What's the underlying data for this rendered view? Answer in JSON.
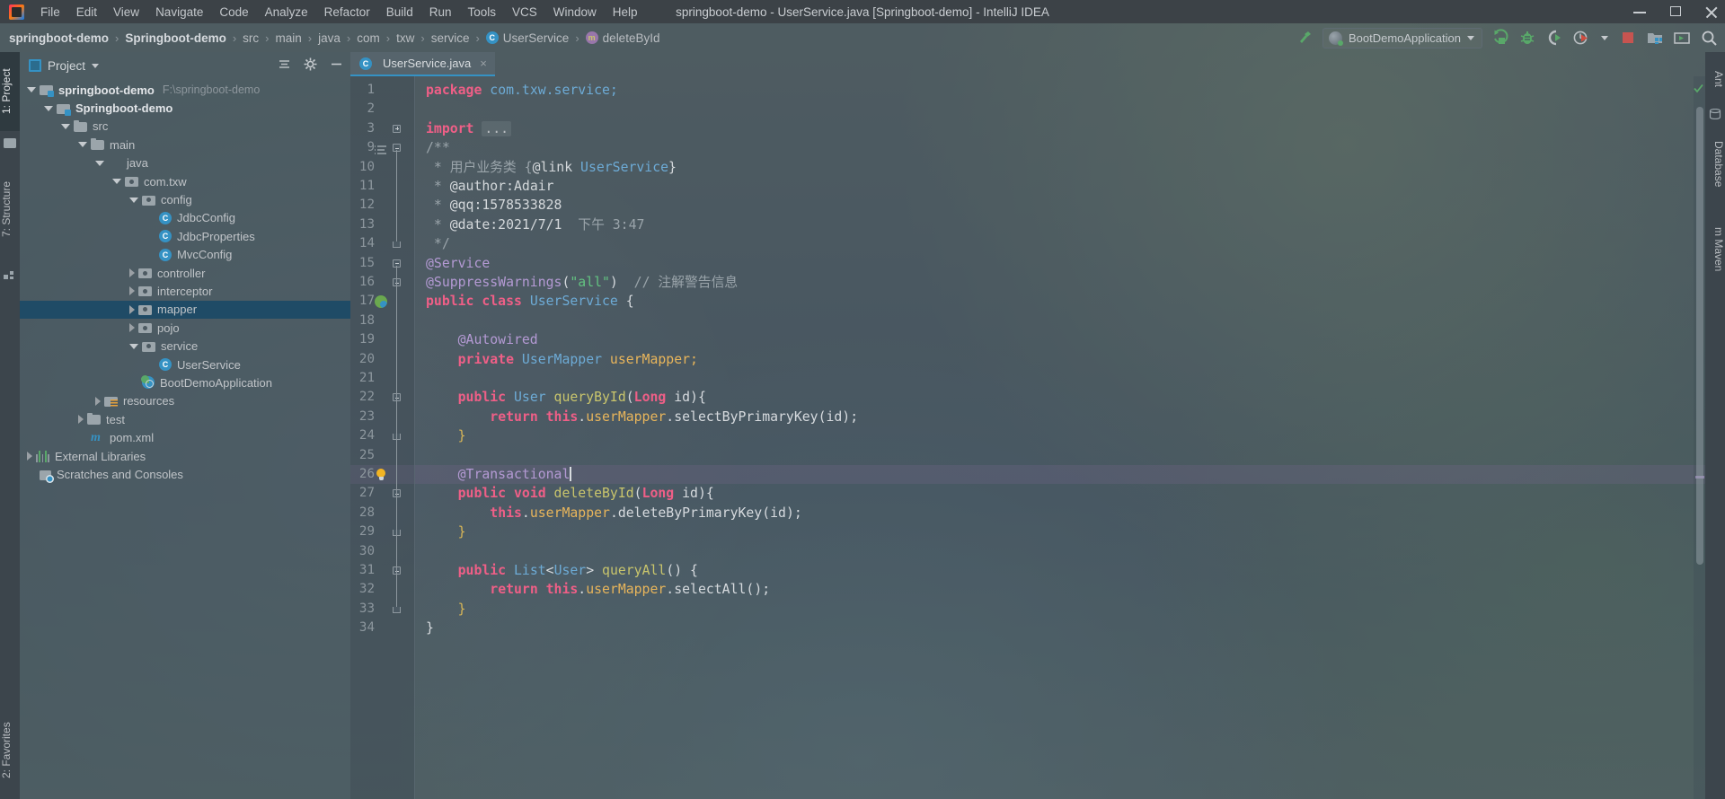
{
  "window": {
    "title": "springboot-demo - UserService.java [Springboot-demo] - IntelliJ IDEA",
    "minimize_label": "Minimize",
    "maximize_label": "Maximize",
    "close_label": "Close"
  },
  "menu": {
    "logo_name": "intellij-idea-logo",
    "items": [
      {
        "label": "File"
      },
      {
        "label": "Edit"
      },
      {
        "label": "View"
      },
      {
        "label": "Navigate"
      },
      {
        "label": "Code"
      },
      {
        "label": "Analyze"
      },
      {
        "label": "Refactor"
      },
      {
        "label": "Build"
      },
      {
        "label": "Run"
      },
      {
        "label": "Tools"
      },
      {
        "label": "VCS"
      },
      {
        "label": "Window"
      },
      {
        "label": "Help"
      }
    ]
  },
  "breadcrumb": {
    "items": [
      {
        "label": "springboot-demo",
        "bold": true,
        "icon": ""
      },
      {
        "label": "Springboot-demo",
        "bold": true,
        "icon": ""
      },
      {
        "label": "src",
        "bold": false,
        "icon": ""
      },
      {
        "label": "main",
        "bold": false,
        "icon": ""
      },
      {
        "label": "java",
        "bold": false,
        "icon": ""
      },
      {
        "label": "com",
        "bold": false,
        "icon": ""
      },
      {
        "label": "txw",
        "bold": false,
        "icon": ""
      },
      {
        "label": "service",
        "bold": false,
        "icon": ""
      },
      {
        "label": "UserService",
        "bold": false,
        "icon": "C"
      },
      {
        "label": "deleteById",
        "bold": false,
        "icon": "m"
      }
    ],
    "separator": "›"
  },
  "toolbar": {
    "run_config_label": "BootDemoApplication",
    "icons": [
      {
        "name": "build-hammer-icon"
      },
      {
        "name": "run-icon"
      },
      {
        "name": "debug-icon"
      },
      {
        "name": "run-with-coverage-icon"
      },
      {
        "name": "profiler-icon"
      },
      {
        "name": "profiler-dropdown-icon"
      },
      {
        "name": "stop-icon"
      },
      {
        "name": "project-structure-icon"
      },
      {
        "name": "terminal-icon"
      },
      {
        "name": "search-everywhere-icon"
      }
    ]
  },
  "left_strip": {
    "tabs": [
      {
        "label": "1: Project",
        "active": true
      },
      {
        "label": "7: Structure",
        "active": false
      }
    ],
    "bottom_tabs": [
      {
        "label": "2: Favorites"
      }
    ],
    "icons": [
      {
        "name": "project-folder-icon"
      },
      {
        "name": "structure-icon"
      }
    ]
  },
  "right_strip": {
    "tabs": [
      {
        "label": "Ant",
        "active": false
      },
      {
        "label": "Database",
        "active": false
      },
      {
        "label": "m Maven",
        "active": false
      }
    ]
  },
  "project_panel": {
    "title": "Project",
    "dropdown_name": "project-view-dropdown",
    "collapse_all_name": "collapse-all-icon",
    "settings_name": "gear-icon",
    "hide_name": "hide-icon",
    "tree": [
      {
        "label": "springboot-demo",
        "path": "F:\\springboot-demo",
        "depth": 0,
        "twisty": "down",
        "icon": "mod",
        "bold": true,
        "selected": false
      },
      {
        "label": "Springboot-demo",
        "path": "",
        "depth": 1,
        "twisty": "down",
        "icon": "mod",
        "bold": true,
        "selected": false
      },
      {
        "label": "src",
        "path": "",
        "depth": 2,
        "twisty": "down",
        "icon": "folder",
        "bold": false,
        "selected": false
      },
      {
        "label": "main",
        "path": "",
        "depth": 3,
        "twisty": "down",
        "icon": "folder",
        "bold": false,
        "selected": false
      },
      {
        "label": "java",
        "path": "",
        "depth": 4,
        "twisty": "down",
        "icon": "folder-blue",
        "bold": false,
        "selected": false
      },
      {
        "label": "com.txw",
        "path": "",
        "depth": 5,
        "twisty": "down",
        "icon": "pkg",
        "bold": false,
        "selected": false
      },
      {
        "label": "config",
        "path": "",
        "depth": 6,
        "twisty": "down",
        "icon": "pkg",
        "bold": false,
        "selected": false
      },
      {
        "label": "JdbcConfig",
        "path": "",
        "depth": 7,
        "twisty": "none",
        "icon": "cls",
        "bold": false,
        "selected": false
      },
      {
        "label": "JdbcProperties",
        "path": "",
        "depth": 7,
        "twisty": "none",
        "icon": "cls",
        "bold": false,
        "selected": false
      },
      {
        "label": "MvcConfig",
        "path": "",
        "depth": 7,
        "twisty": "none",
        "icon": "cls",
        "bold": false,
        "selected": false
      },
      {
        "label": "controller",
        "path": "",
        "depth": 6,
        "twisty": "right",
        "icon": "pkg",
        "bold": false,
        "selected": false
      },
      {
        "label": "interceptor",
        "path": "",
        "depth": 6,
        "twisty": "right",
        "icon": "pkg",
        "bold": false,
        "selected": false
      },
      {
        "label": "mapper",
        "path": "",
        "depth": 6,
        "twisty": "right",
        "icon": "pkg",
        "bold": false,
        "selected": true
      },
      {
        "label": "pojo",
        "path": "",
        "depth": 6,
        "twisty": "right",
        "icon": "pkg",
        "bold": false,
        "selected": false
      },
      {
        "label": "service",
        "path": "",
        "depth": 6,
        "twisty": "down",
        "icon": "pkg",
        "bold": false,
        "selected": false
      },
      {
        "label": "UserService",
        "path": "",
        "depth": 7,
        "twisty": "none",
        "icon": "cls",
        "bold": false,
        "selected": false
      },
      {
        "label": "BootDemoApplication",
        "path": "",
        "depth": 6,
        "twisty": "none",
        "icon": "spring",
        "bold": false,
        "selected": false
      },
      {
        "label": "resources",
        "path": "",
        "depth": 4,
        "twisty": "right",
        "icon": "res",
        "bold": false,
        "selected": false
      },
      {
        "label": "test",
        "path": "",
        "depth": 3,
        "twisty": "right",
        "icon": "folder",
        "bold": false,
        "selected": false
      },
      {
        "label": "pom.xml",
        "path": "",
        "depth": 3,
        "twisty": "none",
        "icon": "maven",
        "bold": false,
        "selected": false
      },
      {
        "label": "External Libraries",
        "path": "",
        "depth": 0,
        "twisty": "right",
        "icon": "libs",
        "bold": false,
        "selected": false
      },
      {
        "label": "Scratches and Consoles",
        "path": "",
        "depth": 0,
        "twisty": "none",
        "icon": "scratch",
        "bold": false,
        "selected": false
      }
    ]
  },
  "editor": {
    "tab": {
      "label": "UserService.java",
      "icon": "C",
      "close": "×"
    },
    "caret_line": 26,
    "code_lines": [
      {
        "num": "1",
        "tokens": [
          {
            "t": "package ",
            "c": "k"
          },
          {
            "t": "com.txw.service;",
            "c": "ty"
          }
        ]
      },
      {
        "num": "2",
        "tokens": []
      },
      {
        "num": "3",
        "tokens": [
          {
            "t": "import ",
            "c": "k"
          },
          {
            "t": "...",
            "c": "fold-tag"
          }
        ]
      },
      {
        "num": "9",
        "tokens": [
          {
            "t": "/**",
            "c": "docT"
          }
        ]
      },
      {
        "num": "10",
        "tokens": [
          {
            "t": " * ",
            "c": "docT"
          },
          {
            "t": "用户业务类 ",
            "c": "docT"
          },
          {
            "t": "{",
            "c": "docT"
          },
          {
            "t": "@link",
            "c": "doc"
          },
          {
            "t": " ",
            "c": "doc"
          },
          {
            "t": "UserService",
            "c": "lnk"
          },
          {
            "t": "}",
            "c": "doc"
          }
        ]
      },
      {
        "num": "11",
        "tokens": [
          {
            "t": " * ",
            "c": "docT"
          },
          {
            "t": "@author:Adair",
            "c": "doc"
          }
        ]
      },
      {
        "num": "12",
        "tokens": [
          {
            "t": " * ",
            "c": "docT"
          },
          {
            "t": "@qq:1578533828",
            "c": "doc"
          }
        ]
      },
      {
        "num": "13",
        "tokens": [
          {
            "t": " * ",
            "c": "docT"
          },
          {
            "t": "@date:2021/7/1",
            "c": "doc"
          },
          {
            "t": "  下午 3:47",
            "c": "docT"
          }
        ]
      },
      {
        "num": "14",
        "tokens": [
          {
            "t": " */",
            "c": "docT"
          }
        ]
      },
      {
        "num": "15",
        "tokens": [
          {
            "t": "@Service",
            "c": "an"
          }
        ]
      },
      {
        "num": "16",
        "tokens": [
          {
            "t": "@SuppressWarnings",
            "c": "an"
          },
          {
            "t": "(",
            "c": "pn"
          },
          {
            "t": "\"all\"",
            "c": "st"
          },
          {
            "t": ")",
            "c": "pn"
          },
          {
            "t": "  // 注解警告信息",
            "c": "cm"
          }
        ]
      },
      {
        "num": "17",
        "tokens": [
          {
            "t": "public class ",
            "c": "k"
          },
          {
            "t": "UserService",
            "c": "ty"
          },
          {
            "t": " {",
            "c": "pn"
          }
        ]
      },
      {
        "num": "18",
        "tokens": []
      },
      {
        "num": "19",
        "tokens": [
          {
            "t": "    @Autowired",
            "c": "an"
          }
        ]
      },
      {
        "num": "20",
        "tokens": [
          {
            "t": "    ",
            "c": "pn"
          },
          {
            "t": "private ",
            "c": "k"
          },
          {
            "t": "UserMapper ",
            "c": "ty"
          },
          {
            "t": "userMapper;",
            "c": "fld"
          }
        ]
      },
      {
        "num": "21",
        "tokens": []
      },
      {
        "num": "22",
        "tokens": [
          {
            "t": "    ",
            "c": "pn"
          },
          {
            "t": "public ",
            "c": "k"
          },
          {
            "t": "User ",
            "c": "ty"
          },
          {
            "t": "queryById",
            "c": "mth"
          },
          {
            "t": "(",
            "c": "pn"
          },
          {
            "t": "Long",
            "c": "k"
          },
          {
            "t": " id",
            "c": "pn"
          },
          {
            "t": "){",
            "c": "pn"
          }
        ]
      },
      {
        "num": "23",
        "tokens": [
          {
            "t": "        ",
            "c": "pn"
          },
          {
            "t": "return ",
            "c": "k"
          },
          {
            "t": "this",
            "c": "k"
          },
          {
            "t": ".",
            "c": "pn"
          },
          {
            "t": "userMapper",
            "c": "fld"
          },
          {
            "t": ".",
            "c": "pn"
          },
          {
            "t": "selectByPrimaryKey",
            "c": "pn"
          },
          {
            "t": "(id);",
            "c": "pn"
          }
        ]
      },
      {
        "num": "24",
        "tokens": [
          {
            "t": "    }",
            "c": "br"
          }
        ]
      },
      {
        "num": "25",
        "tokens": []
      },
      {
        "num": "26",
        "tokens": [
          {
            "t": "    @Transactional",
            "c": "an"
          }
        ],
        "caret": true
      },
      {
        "num": "27",
        "tokens": [
          {
            "t": "    ",
            "c": "pn"
          },
          {
            "t": "public void ",
            "c": "k"
          },
          {
            "t": "deleteById",
            "c": "mth"
          },
          {
            "t": "(",
            "c": "pn"
          },
          {
            "t": "Long",
            "c": "k"
          },
          {
            "t": " id",
            "c": "pn"
          },
          {
            "t": "){",
            "c": "pn"
          }
        ]
      },
      {
        "num": "28",
        "tokens": [
          {
            "t": "        ",
            "c": "pn"
          },
          {
            "t": "this",
            "c": "k"
          },
          {
            "t": ".",
            "c": "pn"
          },
          {
            "t": "userMapper",
            "c": "fld"
          },
          {
            "t": ".",
            "c": "pn"
          },
          {
            "t": "deleteByPrimaryKey",
            "c": "pn"
          },
          {
            "t": "(id);",
            "c": "pn"
          }
        ]
      },
      {
        "num": "29",
        "tokens": [
          {
            "t": "    }",
            "c": "br"
          }
        ]
      },
      {
        "num": "30",
        "tokens": []
      },
      {
        "num": "31",
        "tokens": [
          {
            "t": "    ",
            "c": "pn"
          },
          {
            "t": "public ",
            "c": "k"
          },
          {
            "t": "List",
            "c": "ty"
          },
          {
            "t": "<",
            "c": "pn"
          },
          {
            "t": "User",
            "c": "ty"
          },
          {
            "t": "> ",
            "c": "pn"
          },
          {
            "t": "queryAll",
            "c": "mth"
          },
          {
            "t": "() {",
            "c": "pn"
          }
        ]
      },
      {
        "num": "32",
        "tokens": [
          {
            "t": "        ",
            "c": "pn"
          },
          {
            "t": "return ",
            "c": "k"
          },
          {
            "t": "this",
            "c": "k"
          },
          {
            "t": ".",
            "c": "pn"
          },
          {
            "t": "userMapper",
            "c": "fld"
          },
          {
            "t": ".",
            "c": "pn"
          },
          {
            "t": "selectAll",
            "c": "pn"
          },
          {
            "t": "();",
            "c": "pn"
          }
        ]
      },
      {
        "num": "33",
        "tokens": [
          {
            "t": "    }",
            "c": "br"
          }
        ]
      },
      {
        "num": "34",
        "tokens": [
          {
            "t": "}",
            "c": "pn"
          }
        ]
      }
    ]
  },
  "colors": {
    "accent_blue": "#3592c4",
    "keyword_pink": "#ef5f87",
    "annotation_purple": "#b49ad4",
    "string_green": "#63c381",
    "field_gold": "#e8b55b",
    "selection_blue": "#1f4b66",
    "ok_green": "#59a869",
    "stop_red": "#c75450"
  }
}
